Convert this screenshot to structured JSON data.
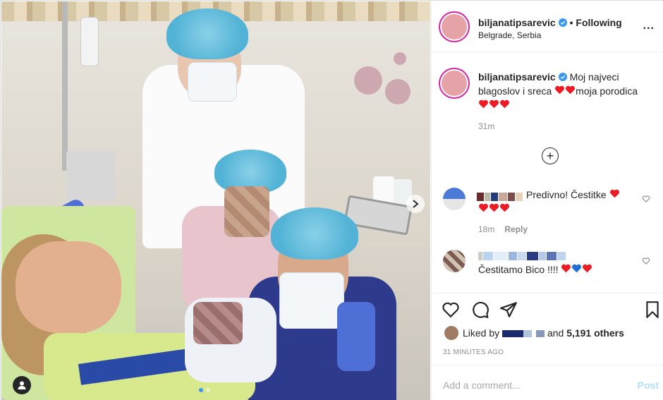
{
  "post": {
    "username": "biljanatipsarevic",
    "follow_sep": "•",
    "follow_label": "Following",
    "location": "Belgrade, Serbia",
    "more_label": "...",
    "caption_user": "biljanatipsarevic",
    "caption_text_1": "Moj najveci blagoslov i sreca",
    "caption_text_2": "moja porodica",
    "time": "31m",
    "likes_prefix": "Liked by",
    "likes_suffix": "and",
    "likes_count": "5,191 others",
    "posted_ago": "31 MINUTES AGO",
    "add_comment_placeholder": "Add a comment...",
    "post_label": "Post"
  },
  "comments": [
    {
      "text": "Predivno! Čestitke",
      "time": "18m",
      "reply": "Reply"
    },
    {
      "text": "Čestitamo Bico !!!!",
      "time": "",
      "reply": ""
    }
  ],
  "colors": {
    "heart_red": "#ed1c24",
    "heart_blue": "#1d6fd6",
    "verified_blue": "#3897f0",
    "gradient_ring": "#d6249f"
  }
}
